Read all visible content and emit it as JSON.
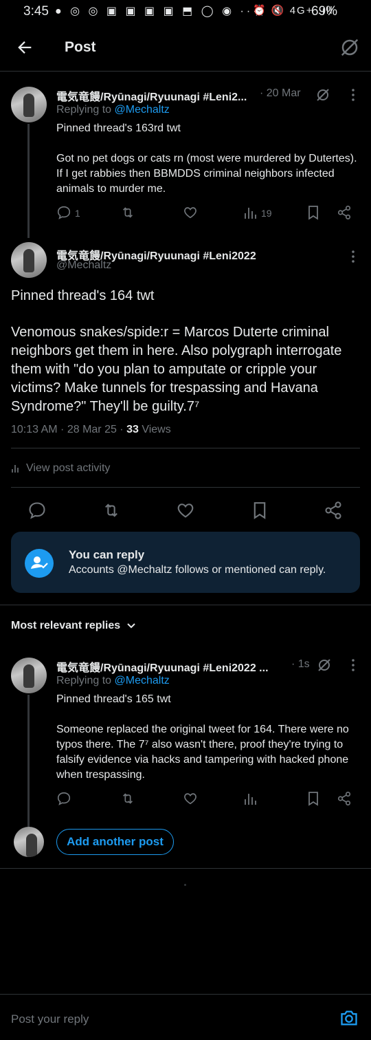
{
  "status_bar": {
    "time": "3:45",
    "notif_icons": "● ◎ ◎ ▣ ▣ ▣ ▣ ⬒ ◯ ◉ ···",
    "system_icons": "⏰ 🔇 4G+ .ıll",
    "battery": "69%"
  },
  "header": {
    "title": "Post"
  },
  "parent_tweet": {
    "name": "電気竜饅/Ryūnagi/Ryuunagi #Leni2...",
    "time": "· 20 Mar",
    "replying_prefix": "Replying to ",
    "replying_handle": "@Mechaltz",
    "text_line1": "Pinned thread's 163rd twt",
    "text_para": "Got no pet dogs or cats rn (most were murdered by Dutertes). If I get rabbies then BBMDDS criminal neighbors infected animals  to murder me.",
    "reply_count": "1",
    "views": "19"
  },
  "main_tweet": {
    "name": "電気竜饅/Ryūnagi/Ryuunagi #Leni2022",
    "handle": "@Mechaltz",
    "text_line1": "Pinned thread's 164 twt",
    "text_para": "Venomous snakes/spide:r = Marcos Duterte criminal neighbors get them in here. Also polygraph interrogate them with \"do you plan to amputate or cripple your victims? Make tunnels for trespassing and Havana Syndrome?\" They'll be guilty.7⁷",
    "timestamp": "10:13 AM · 28 Mar 25 · ",
    "views_count": "33",
    "views_label": " Views",
    "activity_label": "View post activity"
  },
  "reply_card": {
    "title": "You can reply",
    "subtitle": "Accounts @Mechaltz follows or mentioned can reply."
  },
  "sort": {
    "label": "Most relevant replies"
  },
  "reply_tweet": {
    "name": "電気竜饅/Ryūnagi/Ryuunagi #Leni2022 ...",
    "time": "· 1s",
    "replying_prefix": "Replying to ",
    "replying_handle": "@Mechaltz",
    "text_line1": "Pinned thread's 165 twt",
    "text_para": "Someone replaced the original tweet for 164. There were no typos there. The 7⁷ also wasn't there, proof they're trying to falsify evidence via hacks and tampering with hacked phone when trespassing."
  },
  "add_post": {
    "label": "Add another post"
  },
  "composer": {
    "placeholder": "Post your reply"
  },
  "icons": [
    "back-arrow-icon",
    "grok-icon",
    "more-icon",
    "reply-icon",
    "repost-icon",
    "like-icon",
    "views-icon",
    "bookmark-icon",
    "share-icon",
    "add-user-check-icon",
    "chevron-down-icon",
    "camera-icon",
    "activity-icon"
  ],
  "colors": {
    "accent": "#1d9bf0",
    "muted": "#71767b",
    "text": "#e7e9ea",
    "background": "#000000",
    "card": "#0f2234"
  }
}
